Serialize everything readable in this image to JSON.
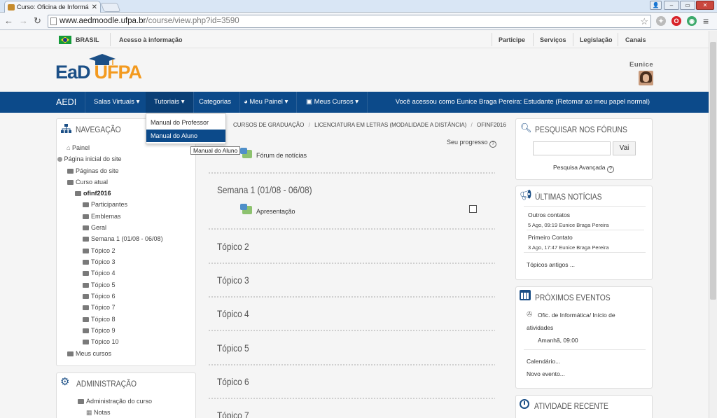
{
  "browser": {
    "tab_title": "Curso: Oficina de Informá",
    "url_host": "www.aedmoodle.ufpa.br",
    "url_path": "/course/view.php?id=3590"
  },
  "govbar": {
    "country": "BRASIL",
    "access_info": "Acesso à informação",
    "links": [
      "Participe",
      "Serviços",
      "Legislação",
      "Canais"
    ]
  },
  "header": {
    "logo_ead": "EaD",
    "logo_ufpa": "UFPA",
    "username": "Eunice"
  },
  "navbar": {
    "brand": "AEDI",
    "items": [
      "Salas Virtuais",
      "Tutoriais",
      "Categorias",
      "Meu Painel",
      "Meus Cursos"
    ],
    "role_notice": "Você acessou como Eunice Braga Pereira: Estudante (Retomar ao meu papel normal)"
  },
  "dropdown": {
    "items": [
      "Manual do Professor",
      "Manual do Aluno"
    ],
    "tooltip": "Manual do Aluno"
  },
  "navegacao": {
    "title": "NAVEGAÇÃO",
    "painel": "Painel",
    "pagina_inicial": "Página inicial do site",
    "paginas_site": "Páginas do site",
    "curso_atual": "Curso atual",
    "curso": "ofinf2016",
    "items": [
      "Participantes",
      "Emblemas",
      "Geral",
      "Semana 1 (01/08 - 06/08)",
      "Tópico 2",
      "Tópico 3",
      "Tópico 4",
      "Tópico 5",
      "Tópico 6",
      "Tópico 7",
      "Tópico 8",
      "Tópico 9",
      "Tópico 10"
    ],
    "meus_cursos": "Meus cursos"
  },
  "administracao": {
    "title": "ADMINISTRAÇÃO",
    "admin_curso": "Administração do curso",
    "notas": "Notas"
  },
  "breadcrumb": [
    "CURSOS DE GRADUAÇÃO",
    "LICENCIATURA EM LETRAS (MODALIDADE A DISTÂNCIA)",
    "OFINF2016"
  ],
  "main": {
    "seu_progresso": "Seu progresso",
    "forum_noticias": "Fórum de notícias",
    "semana1": "Semana 1 (01/08 - 06/08)",
    "apresentacao": "Apresentação",
    "topicos": [
      "Tópico 2",
      "Tópico 3",
      "Tópico 4",
      "Tópico 5",
      "Tópico 6",
      "Tópico 7"
    ]
  },
  "forum_search": {
    "title": "PESQUISAR NOS FÓRUNS",
    "button": "Vai",
    "advanced": "Pesquisa Avançada"
  },
  "noticias": {
    "title": "ÚLTIMAS NOTÍCIAS",
    "items": [
      {
        "title": "Outros contatos",
        "meta": "5 Ago, 09:19  Eunice Braga Pereira"
      },
      {
        "title": "Primeiro Contato",
        "meta": "3 Ago, 17:47  Eunice Braga Pereira"
      }
    ],
    "older": "Tópicos antigos ..."
  },
  "eventos": {
    "title": "PRÓXIMOS EVENTOS",
    "event_line1": "Ofic. de Informática/ Início de",
    "event_line2": "atividades",
    "event_time": "Amanhã, 09:00",
    "calendar": "Calendário...",
    "new_event": "Novo evento..."
  },
  "atividade": {
    "title": "ATIVIDADE RECENTE"
  },
  "colors": {
    "nav_blue": "#0c4a8a",
    "logo_blue": "#1b4f86",
    "logo_orange": "#f39a1f"
  }
}
